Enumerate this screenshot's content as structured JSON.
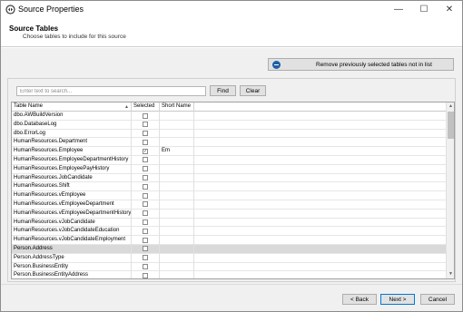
{
  "window": {
    "title": "Source Properties",
    "minimize_glyph": "—",
    "maximize_glyph": "☐",
    "close_glyph": "✕"
  },
  "header": {
    "title": "Source Tables",
    "subtitle": "Choose tables to include for this source"
  },
  "remove_button": {
    "label": "Remove previously selected tables not in list",
    "icon": "minus-circle-icon"
  },
  "search": {
    "value": "",
    "placeholder": "Enter text to search...",
    "find_label": "Find",
    "clear_label": "Clear"
  },
  "grid": {
    "columns": {
      "name": "Table Name",
      "selected": "Selected",
      "short_name": "Short Name"
    },
    "rows": [
      {
        "name": "dbo.AWBuildVersion",
        "checked": "",
        "short": ""
      },
      {
        "name": "dbo.DatabaseLog",
        "checked": "",
        "short": ""
      },
      {
        "name": "dbo.ErrorLog",
        "checked": "",
        "short": ""
      },
      {
        "name": "HumanResources.Department",
        "checked": "",
        "short": ""
      },
      {
        "name": "HumanResources.Employee",
        "checked": "✓",
        "short": "Em"
      },
      {
        "name": "HumanResources.EmployeeDepartmentHistory",
        "checked": "",
        "short": ""
      },
      {
        "name": "HumanResources.EmployeePayHistory",
        "checked": "",
        "short": ""
      },
      {
        "name": "HumanResources.JobCandidate",
        "checked": "",
        "short": ""
      },
      {
        "name": "HumanResources.Shift",
        "checked": "",
        "short": ""
      },
      {
        "name": "HumanResources.vEmployee",
        "checked": "",
        "short": ""
      },
      {
        "name": "HumanResources.vEmployeeDepartment",
        "checked": "",
        "short": ""
      },
      {
        "name": "HumanResources.vEmployeeDepartmentHistory",
        "checked": "",
        "short": ""
      },
      {
        "name": "HumanResources.vJobCandidate",
        "checked": "",
        "short": ""
      },
      {
        "name": "HumanResources.vJobCandidateEducation",
        "checked": "",
        "short": ""
      },
      {
        "name": "HumanResources.vJobCandidateEmployment",
        "checked": "",
        "short": ""
      },
      {
        "name": "Person.Address",
        "checked": "",
        "short": ""
      },
      {
        "name": "Person.AddressType",
        "checked": "",
        "short": ""
      },
      {
        "name": "Person.BusinessEntity",
        "checked": "",
        "short": ""
      },
      {
        "name": "Person.BusinessEntityAddress",
        "checked": "",
        "short": ""
      }
    ]
  },
  "footer": {
    "back_label": "< Back",
    "next_label": "Next >",
    "cancel_label": "Cancel"
  }
}
